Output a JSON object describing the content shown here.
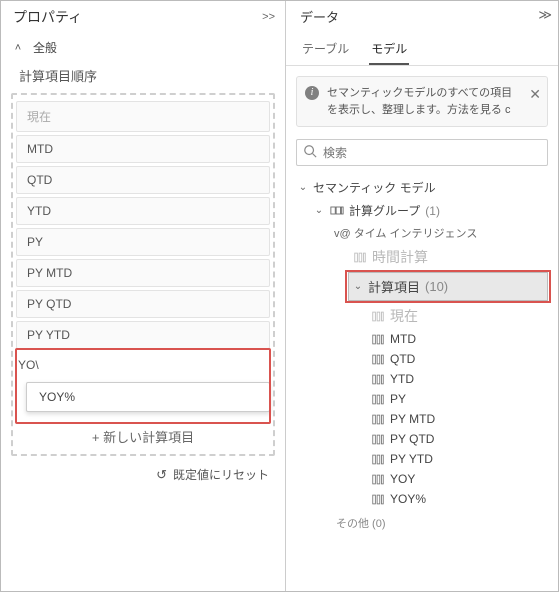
{
  "left": {
    "title": "プロパティ",
    "expand": ">>",
    "section": "全般",
    "subsection": "計算項目順序",
    "items": [
      "現在",
      "MTD",
      "QTD",
      "YTD",
      "PY",
      "PY MTD",
      "PY QTD",
      "PY YTD",
      "YOY"
    ],
    "yoy_trunc": "YO\\",
    "yoy_popup": "YOY%",
    "add": "+ 新しい計算項目",
    "reset": "既定値にリセット"
  },
  "right": {
    "title": "データ",
    "collapse": "≫",
    "tabs": {
      "table": "テーブル",
      "model": "モデル"
    },
    "notice": "セマンティックモデルのすべての項目を表示し、整理します。方法を見る c",
    "search_ph": "検索",
    "root": "セマンティック モデル",
    "group": {
      "label": "計算グループ",
      "count": "(1)"
    },
    "v_at": "v@ タイム インテリジェンス",
    "time_calc": "時間計算",
    "calc_items": {
      "label": "計算項目",
      "count": "(10)"
    },
    "leaves": [
      "現在",
      "MTD",
      "QTD",
      "YTD",
      "PY",
      "PY MTD",
      "PY QTD",
      "PY YTD",
      "YOY",
      "YOY%"
    ],
    "others": "その他 (0)"
  }
}
